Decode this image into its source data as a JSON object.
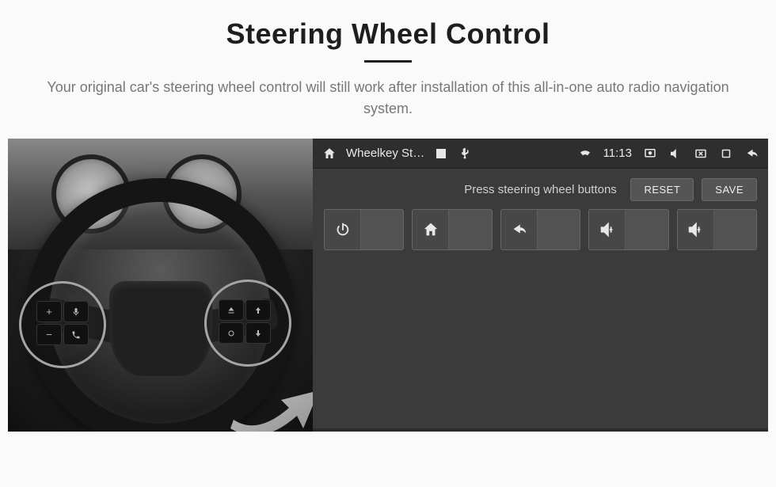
{
  "header": {
    "title": "Steering Wheel Control",
    "subtitle": "Your original car's steering wheel control will still work after installation of this all-in-one auto radio navigation system."
  },
  "statusbar": {
    "app_title": "Wheelkey St…",
    "time": "11:13"
  },
  "hint": {
    "text": "Press steering wheel buttons",
    "reset_label": "RESET",
    "save_label": "SAVE"
  },
  "assign_slots": [
    {
      "name": "power",
      "icon": "power-icon"
    },
    {
      "name": "home",
      "icon": "home-icon"
    },
    {
      "name": "back",
      "icon": "back-icon"
    },
    {
      "name": "volume-up-a",
      "icon": "volume-up-icon"
    },
    {
      "name": "volume-up-b",
      "icon": "volume-up-icon"
    }
  ],
  "wheel_buttons": {
    "left": [
      "+",
      "voice",
      "−",
      "phone"
    ],
    "right": [
      "eject",
      "up",
      "cycle",
      "down"
    ]
  },
  "colors": {
    "accent": "#d9a600",
    "panel": "#3b3b3b",
    "button": "#525252"
  }
}
